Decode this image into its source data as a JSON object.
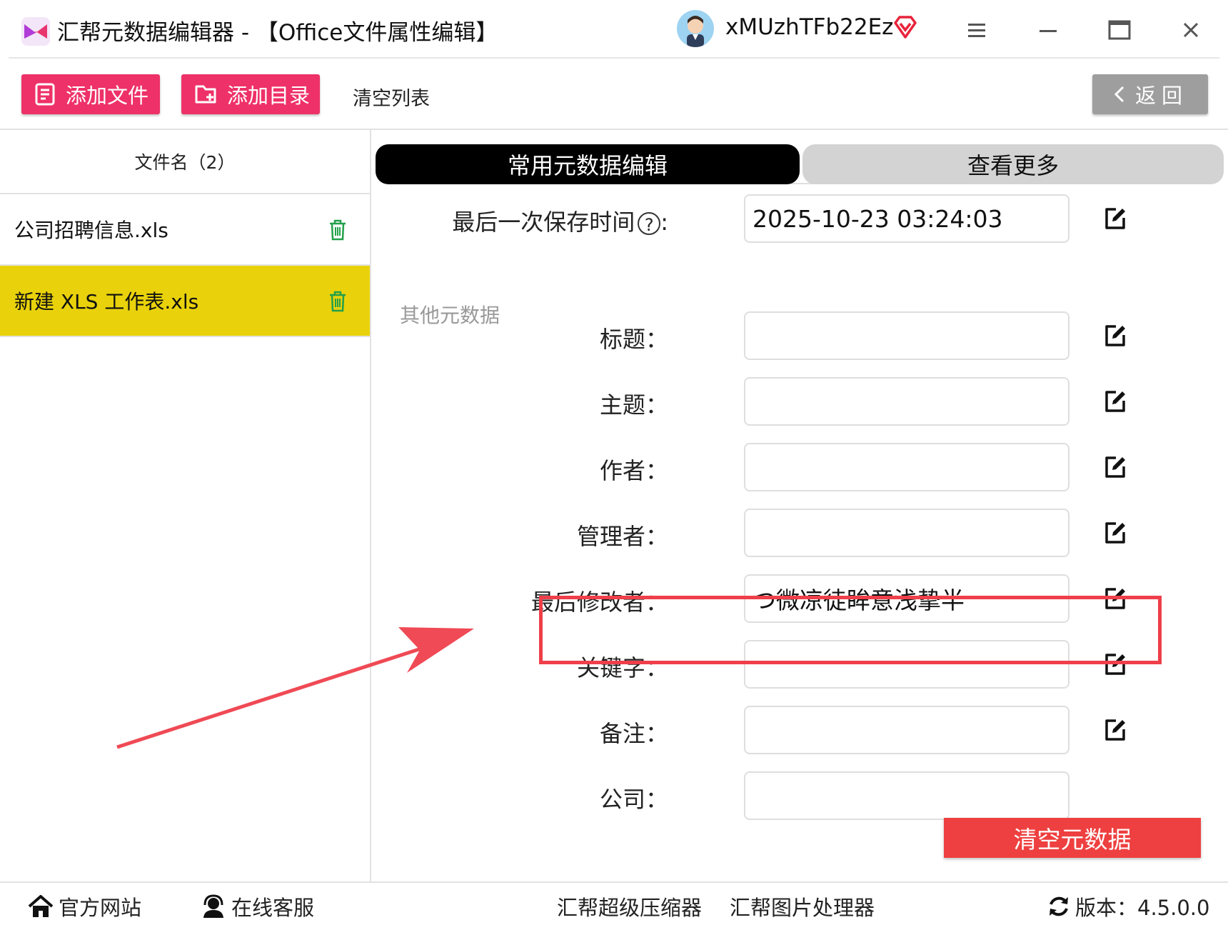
{
  "app": {
    "title": "汇帮元数据编辑器 - 【Office文件属性编辑】",
    "username": "xMUzhTFb22Ez",
    "brand_color": "#ee3168",
    "selected_color": "#e9d20b",
    "danger_color": "#ee4040"
  },
  "toolbar": {
    "add_file": "添加文件",
    "add_dir": "添加目录",
    "clear_list": "清空列表",
    "back": "返回"
  },
  "files": {
    "header": "文件名（2）",
    "items": [
      {
        "name": "公司招聘信息.xls",
        "selected": false
      },
      {
        "name": "新建 XLS 工作表.xls",
        "selected": true
      }
    ]
  },
  "tabs": {
    "active": "常用元数据编辑",
    "more": "查看更多"
  },
  "fields": {
    "last_saved_label": "最后一次保存时间",
    "last_saved_help": "?",
    "last_saved_colon": ":",
    "last_saved_value": "2025-10-23 03:24:03",
    "section_other": "其他元数据",
    "title_label": "标题：",
    "subject_label": "主题：",
    "author_label": "作者：",
    "manager_label": "管理者：",
    "last_modifier_label": "最后修改者：",
    "last_modifier_value": "つ微凉徒眸意浅挚半",
    "keywords_label": "关键字：",
    "notes_label": "备注：",
    "company_label": "公司："
  },
  "actions": {
    "clear_metadata": "清空元数据"
  },
  "status": {
    "website": "官方网站",
    "support": "在线客服",
    "compressor": "汇帮超级压缩器",
    "image_tool": "汇帮图片处理器",
    "version": "版本：4.5.0.0"
  }
}
